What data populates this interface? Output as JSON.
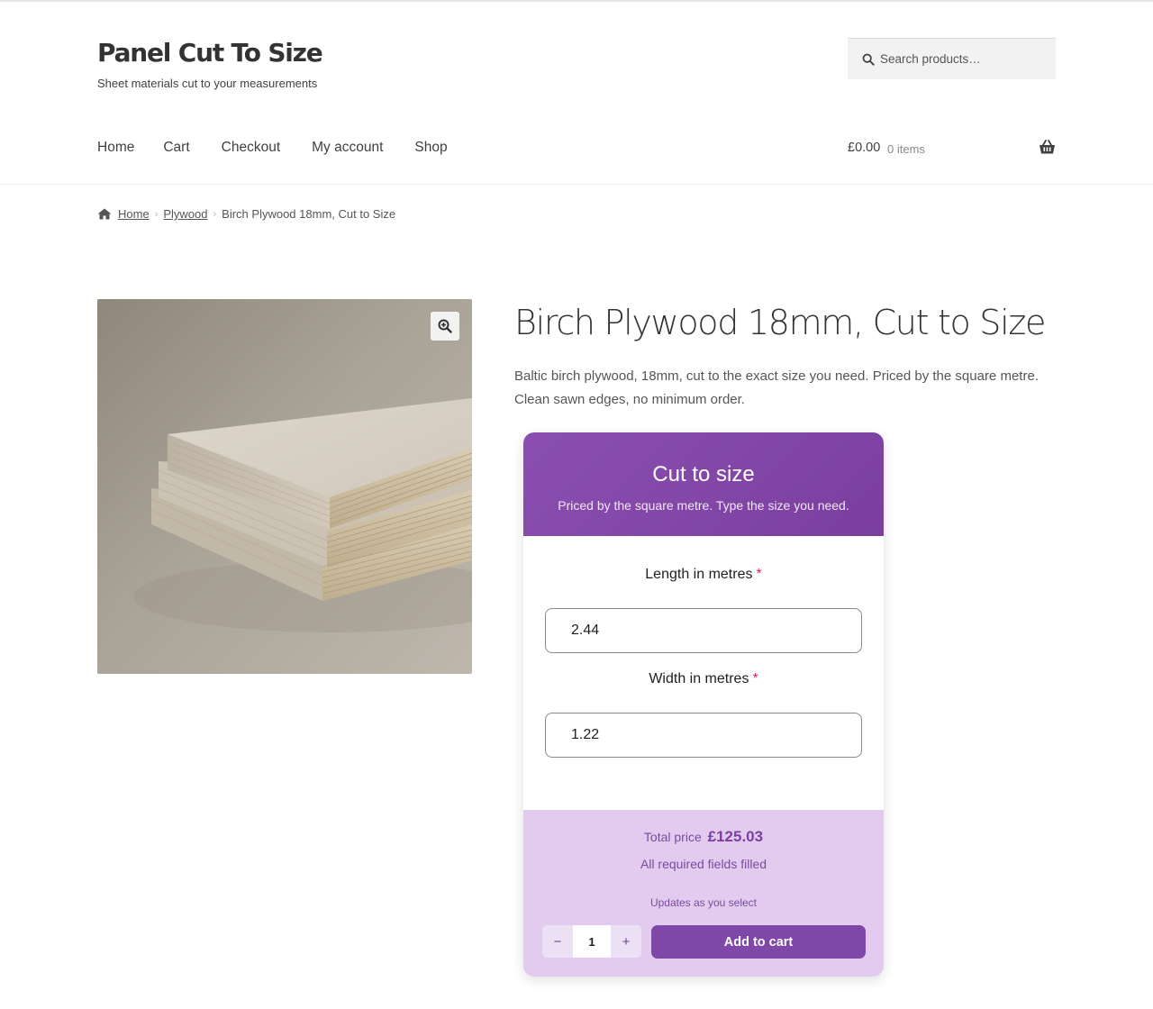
{
  "site": {
    "title": "Panel Cut To Size",
    "tagline": "Sheet materials cut to your measurements"
  },
  "search": {
    "placeholder": "Search products…",
    "icon": "search-icon"
  },
  "nav": {
    "items": [
      "Home",
      "Cart",
      "Checkout",
      "My account",
      "Shop"
    ]
  },
  "cart": {
    "amount": "£0.00",
    "count": "0 items",
    "icon": "basket-icon"
  },
  "breadcrumb": {
    "items": [
      "Home",
      "Plywood",
      "Birch Plywood 18mm, Cut to Size"
    ]
  },
  "product": {
    "title": "Birch Plywood 18mm, Cut to Size",
    "description": "Baltic birch plywood, 18mm, cut to the exact size you need. Priced by the square metre. Clean sawn edges, no minimum order."
  },
  "calculator": {
    "title": "Cut to size",
    "subtitle": "Priced by the square metre. Type the size you need.",
    "fields": [
      {
        "label": "Length in metres",
        "required": "*",
        "value": "2.44"
      },
      {
        "label": "Width in metres",
        "required": "*",
        "value": "1.22"
      }
    ],
    "total_label": "Total price",
    "total_value": "£125.03",
    "status": "All required fields filled",
    "updates_note": "Updates as you select",
    "quantity": {
      "value": "1",
      "minus": "−",
      "plus": "+"
    },
    "add_to_cart": "Add to cart"
  },
  "colors": {
    "accent": "#7e47a8",
    "header_gradient_start": "#8a4fb0",
    "footer_bg": "#e2cbef",
    "required": "#e0245e"
  }
}
